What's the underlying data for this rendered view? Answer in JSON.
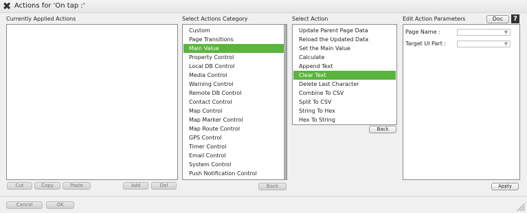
{
  "window": {
    "title": "Actions for 'On tap :'"
  },
  "applied": {
    "label": "Currently Applied Actions",
    "buttons": {
      "cut": "Cut",
      "copy": "Copy",
      "paste": "Paste",
      "add": "Add",
      "del": "Del"
    }
  },
  "category": {
    "label": "Select Actions Category",
    "items": [
      "Custom",
      "Page Transitions",
      "Main Value",
      "Property Control",
      "Local DB Control",
      "Media Control",
      "Warning Control",
      "Remote DB Control",
      "Contact Control",
      "Map Control",
      "Map Marker Control",
      "Map Route Control",
      "GPS Control",
      "Timer Control",
      "Email Control",
      "System Control",
      "Push Notification Control"
    ],
    "selected": "Main Value",
    "back_label": "Back"
  },
  "action": {
    "label": "Select Action",
    "items": [
      "Update Parent Page Data",
      "Reload the Updated Data",
      "Set the Main Value",
      "Calculate",
      "Append Text",
      "Clear Text",
      "Delete Last Character",
      "Combine To CSV",
      "Split To CSV",
      "String To Hex",
      "Hex To String"
    ],
    "selected": "Clear Text",
    "back_label": "Back"
  },
  "params": {
    "label": "Edit Action Parameters",
    "doc_label": "Doc",
    "help_label": "?",
    "fields": [
      {
        "label": "Page Name :",
        "value": ""
      },
      {
        "label": "Target UI Part :",
        "value": ""
      }
    ],
    "apply_label": "Apply"
  },
  "footer": {
    "cancel_label": "Cancel",
    "ok_label": "OK"
  },
  "colors": {
    "selection": "#5ab43e"
  }
}
